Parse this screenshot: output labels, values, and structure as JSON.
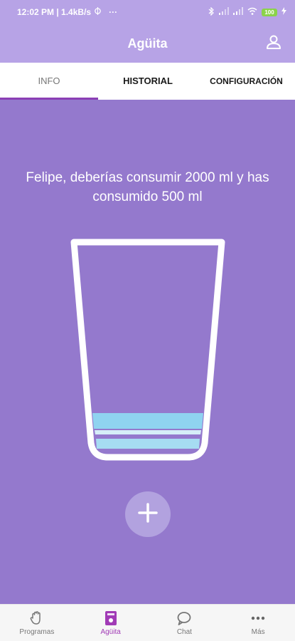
{
  "status_bar": {
    "time_info": "12:02 PM | 1.4kB/s",
    "dots": "···",
    "battery": "100"
  },
  "app_bar": {
    "title": "Agüita"
  },
  "tabs": [
    {
      "label": "INFO"
    },
    {
      "label": "HISTORIAL"
    },
    {
      "label": "CONFIGURACIÓN"
    }
  ],
  "main": {
    "message": "Felipe, deberías consumir 2000 ml y has consumido 500 ml"
  },
  "bottom_nav": [
    {
      "label": "Programas",
      "icon": "hand-icon"
    },
    {
      "label": "Agüita",
      "icon": "water-glass-icon"
    },
    {
      "label": "Chat",
      "icon": "chat-icon"
    },
    {
      "label": "Más",
      "icon": "more-icon"
    }
  ],
  "colors": {
    "background": "#9479cd",
    "app_bar": "#b7a3e6",
    "accent": "#a13bb6",
    "water": "#8fd3f0"
  }
}
